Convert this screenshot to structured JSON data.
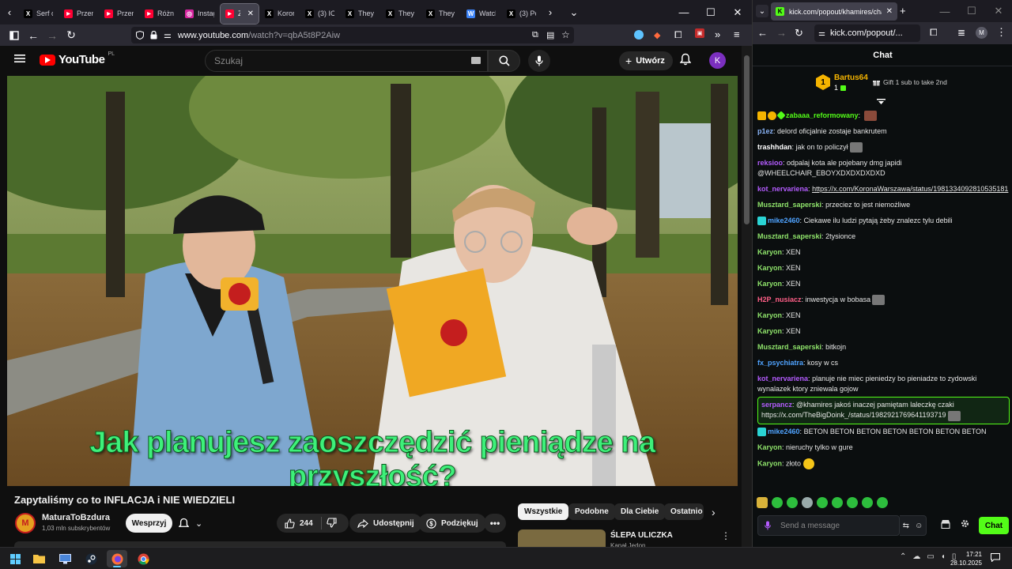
{
  "left_browser": {
    "tabs": [
      {
        "label": "Serf c",
        "icon": "x-icon"
      },
      {
        "label": "Przem",
        "icon": "youtube-icon"
      },
      {
        "label": "Przen",
        "icon": "youtube-icon"
      },
      {
        "label": "Różni",
        "icon": "youtube-icon"
      },
      {
        "label": "Instag",
        "icon": "instagram-icon"
      },
      {
        "label": "Zap",
        "icon": "youtube-icon",
        "active": true
      },
      {
        "label": "Koron",
        "icon": "x-icon"
      },
      {
        "label": "(3) IC",
        "icon": "x-icon"
      },
      {
        "label": "They g",
        "icon": "x-icon"
      },
      {
        "label": "They g",
        "icon": "x-icon"
      },
      {
        "label": "They g",
        "icon": "x-icon"
      },
      {
        "label": "Watch",
        "icon": "watch-icon"
      },
      {
        "label": "(3) Po",
        "icon": "x-icon"
      }
    ],
    "url": "www.youtube.com/watch?v=qbA5t8P2Aiw",
    "url_host": "www.youtube.com",
    "url_path": "/watch?v=qbA5t8P2Aiw"
  },
  "youtube": {
    "logo_text": "YouTube",
    "logo_region": "PL",
    "search_placeholder": "Szukaj",
    "create_label": "Utwórz",
    "avatar_letter": "K",
    "video_caption": "Jak planujesz zaoszczędzić pieniądze na przyszłość?",
    "video_title": "Zapytaliśmy co to INFLACJA i NIE WIEDZIELI",
    "channel_name": "MaturaToBzdura",
    "channel_subs": "1,03 mln subskrybentów",
    "channel_avatar_letter": "M",
    "join_label": "Wesprzyj",
    "likes": "244",
    "share_label": "Udostępnij",
    "thanks_label": "Podziękuj",
    "chips": [
      "Wszystkie",
      "Podobne",
      "Dla Ciebie",
      "Ostatnio"
    ],
    "rec_title": "ŚLEPA ULICZKA",
    "rec_channel": "Kanał Jedon"
  },
  "right_browser": {
    "tab_title": "kick.com/popout/khamires/cha",
    "url": "kick.com/popout/..."
  },
  "chat": {
    "header": "Chat",
    "top_gifter_rank": "1",
    "top_gifter_name": "Bartus64",
    "top_gifter_count": "1",
    "gift_prompt": "Gift 1 sub to take 2nd",
    "messages": [
      {
        "user": "zabaaa_reformowany",
        "color": "#53fc18",
        "text": ""
      },
      {
        "user": "p1ez",
        "color": "#8ab4f8",
        "text": "delord oficjalnie zostaje bankrutem"
      },
      {
        "user": "trashhdan",
        "color": "#ffffff",
        "text": "jak on to policzył"
      },
      {
        "user": "reksioo",
        "color": "#b45cff",
        "text": "odpalaj kota ale pojebany dmg japidi @WHEELCHAIR_EBOYXDXDXDXDXD"
      },
      {
        "user": "kot_nervariena",
        "color": "#b45cff",
        "text": "https://x.com/KoronaWarszawa/status/1981334092810535181"
      },
      {
        "user": "Musztard_saperski",
        "color": "#8fe36b",
        "text": "przeciez to jest niemożliwe"
      },
      {
        "user": "mike2460",
        "color": "#4fa3ff",
        "text": "Ciekawe ilu ludzi pytają żeby znalezc tylu debili"
      },
      {
        "user": "Musztard_saperski",
        "color": "#8fe36b",
        "text": "2tysionce"
      },
      {
        "user": "Karyon",
        "color": "#8fe36b",
        "text": "XEN"
      },
      {
        "user": "Karyon",
        "color": "#8fe36b",
        "text": "XEN"
      },
      {
        "user": "Karyon",
        "color": "#8fe36b",
        "text": "XEN"
      },
      {
        "user": "H2P_nusiacz",
        "color": "#ff5f87",
        "text": "inwestycja w bobasa"
      },
      {
        "user": "Karyon",
        "color": "#8fe36b",
        "text": "XEN"
      },
      {
        "user": "Karyon",
        "color": "#8fe36b",
        "text": "XEN"
      },
      {
        "user": "Musztard_saperski",
        "color": "#8fe36b",
        "text": "bitkojn"
      },
      {
        "user": "fx_psychiatra",
        "color": "#4fa3ff",
        "text": "kosy w cs"
      },
      {
        "user": "kot_nervariena",
        "color": "#b45cff",
        "text": "planuje nie miec pieniedzy bo pieniadze to zydowski wynalazek ktory zniewala gojow"
      },
      {
        "user": "serpancz",
        "color": "#b45cff",
        "text": "@khamires jakoś inaczej pamiętam laleczkę czaki https://x.com/TheBigDoink_/status/1982921769641193719",
        "highlight": true
      },
      {
        "user": "mike2460",
        "color": "#4fa3ff",
        "text": "BETON BETON BETON BETON BETON BETON BETON"
      },
      {
        "user": "Karyon",
        "color": "#8fe36b",
        "text": "nieruchy tylko w gure"
      },
      {
        "user": "Karyon",
        "color": "#8fe36b",
        "text": "złoto"
      }
    ],
    "input_placeholder": "Send a message",
    "send_label": "Chat"
  },
  "taskbar": {
    "time": "17:21",
    "date": "28.10.2025"
  },
  "colors": {
    "kick_green": "#53fc18",
    "youtube_red": "#ff0000",
    "caption_green": "#3ef07a"
  }
}
